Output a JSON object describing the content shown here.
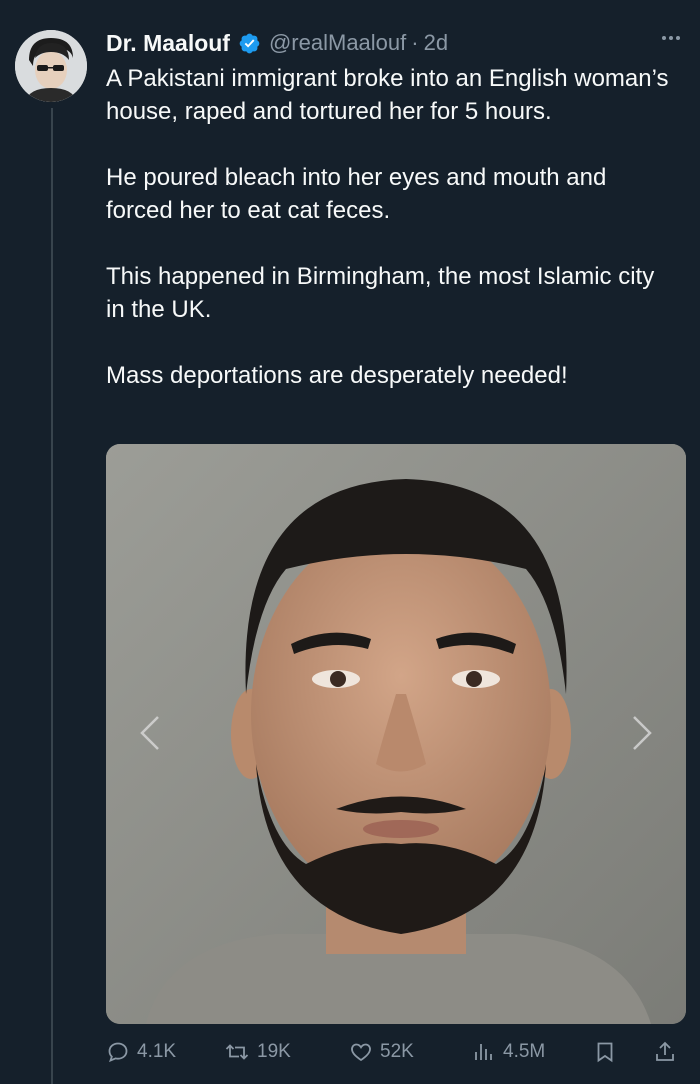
{
  "author": {
    "name": "Dr. Maalouf",
    "handle": "@realMaalouf",
    "separator": "·",
    "time": "2d",
    "verified": true,
    "avatar_icon": "profile-avatar"
  },
  "tweet": {
    "paragraphs": [
      "A Pakistani immigrant broke into an English woman’s house, raped and tortured her for 5 hours.",
      "He poured bleach into her eyes and mouth and forced her to eat cat feces.",
      "This happened in Birmingham, the most Islamic city in the UK.",
      "Mass deportations are desperately needed!"
    ]
  },
  "media": {
    "icon": "mugshot-photo",
    "nav_prev_icon": "chevron-left-icon",
    "nav_next_icon": "chevron-right-icon"
  },
  "actions": {
    "replies": "4.1K",
    "reposts": "19K",
    "likes": "52K",
    "views": "4.5M"
  },
  "colors": {
    "background": "#15202b",
    "text": "#f7f9f9",
    "muted": "#8b98a5",
    "verified": "#1d9bf0",
    "thread_line": "#38444d"
  }
}
